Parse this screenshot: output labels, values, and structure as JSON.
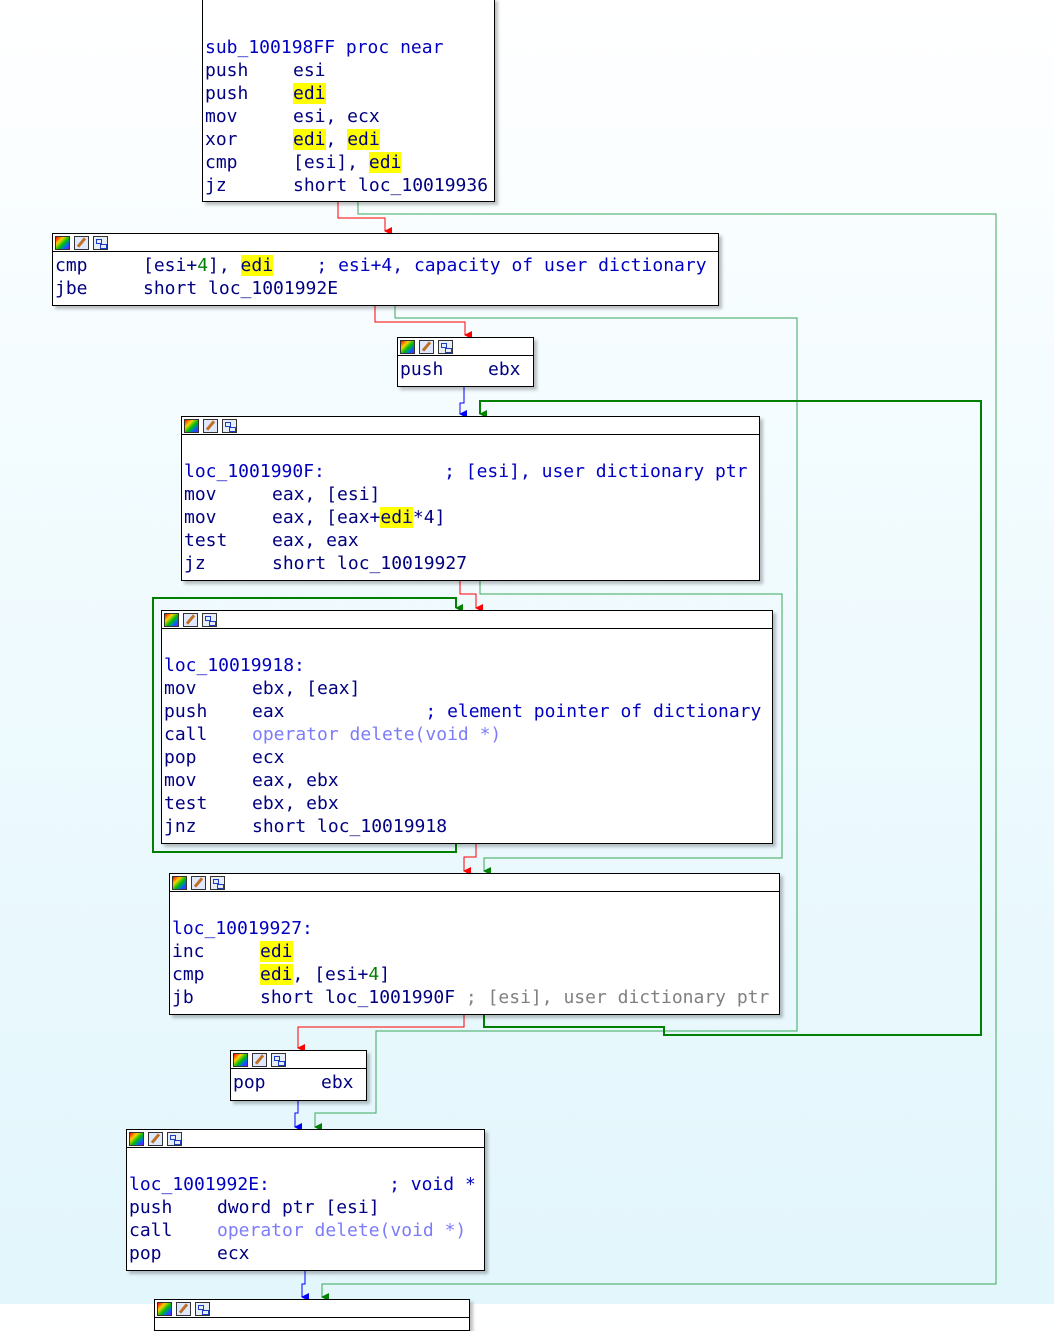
{
  "highlight_word": "edi",
  "blocks": [
    {
      "id": "b1",
      "header": false,
      "lines": [
        {
          "type": "label",
          "text": "sub_100198FF proc near"
        },
        {
          "type": "ins",
          "mn": "push",
          "ops": [
            {
              "t": "esi"
            }
          ]
        },
        {
          "type": "ins",
          "mn": "push",
          "ops": [
            {
              "t": "edi",
              "k": "hl"
            }
          ]
        },
        {
          "type": "ins",
          "mn": "mov",
          "ops": [
            {
              "t": "esi, ecx"
            }
          ]
        },
        {
          "type": "ins",
          "mn": "xor",
          "ops": [
            {
              "t": "edi",
              "k": "hl"
            },
            {
              "t": ", "
            },
            {
              "t": "edi",
              "k": "hl"
            }
          ]
        },
        {
          "type": "ins",
          "mn": "cmp",
          "ops": [
            {
              "t": "[esi], "
            },
            {
              "t": "edi",
              "k": "hl"
            }
          ]
        },
        {
          "type": "ins",
          "mn": "jz",
          "ops": [
            {
              "t": "short loc_10019936"
            }
          ]
        }
      ]
    },
    {
      "id": "b2",
      "header": true,
      "lines": [
        {
          "type": "ins",
          "mn": "cmp",
          "ops": [
            {
              "t": "[esi+"
            },
            {
              "t": "4",
              "k": "num"
            },
            {
              "t": "], "
            },
            {
              "t": "edi",
              "k": "hl"
            },
            {
              "t": "    ; esi+4, capacity of user dictionary",
              "k": "cmt"
            }
          ]
        },
        {
          "type": "ins",
          "mn": "jbe",
          "ops": [
            {
              "t": "short loc_1001992E"
            }
          ]
        }
      ]
    },
    {
      "id": "b3",
      "header": true,
      "lines": [
        {
          "type": "ins",
          "mn": "push",
          "ops": [
            {
              "t": "ebx"
            }
          ]
        }
      ]
    },
    {
      "id": "b4",
      "header": true,
      "lines": [
        {
          "type": "blank",
          "text": ""
        },
        {
          "type": "label",
          "text": "loc_1001990F:           ; [esi], user dictionary ptr"
        },
        {
          "type": "ins",
          "mn": "mov",
          "ops": [
            {
              "t": "eax, [esi]"
            }
          ]
        },
        {
          "type": "ins",
          "mn": "mov",
          "ops": [
            {
              "t": "eax, [eax+"
            },
            {
              "t": "edi",
              "k": "hl"
            },
            {
              "t": "*4]"
            }
          ]
        },
        {
          "type": "ins",
          "mn": "test",
          "ops": [
            {
              "t": "eax, eax"
            }
          ]
        },
        {
          "type": "ins",
          "mn": "jz",
          "ops": [
            {
              "t": "short loc_10019927"
            }
          ]
        }
      ]
    },
    {
      "id": "b5",
      "header": true,
      "lines": [
        {
          "type": "blank",
          "text": ""
        },
        {
          "type": "label",
          "text": "loc_10019918:"
        },
        {
          "type": "ins",
          "mn": "mov",
          "ops": [
            {
              "t": "ebx, [eax]"
            }
          ]
        },
        {
          "type": "ins",
          "mn": "push",
          "ops": [
            {
              "t": "eax"
            },
            {
              "t": "             ; element pointer of dictionary",
              "k": "cmt"
            }
          ]
        },
        {
          "type": "ins",
          "mn": "call",
          "ops": [
            {
              "t": "operator delete(void *)",
              "k": "api"
            }
          ]
        },
        {
          "type": "ins",
          "mn": "pop",
          "ops": [
            {
              "t": "ecx"
            }
          ]
        },
        {
          "type": "ins",
          "mn": "mov",
          "ops": [
            {
              "t": "eax, ebx"
            }
          ]
        },
        {
          "type": "ins",
          "mn": "test",
          "ops": [
            {
              "t": "ebx, ebx"
            }
          ]
        },
        {
          "type": "ins",
          "mn": "jnz",
          "ops": [
            {
              "t": "short loc_10019918"
            }
          ]
        }
      ]
    },
    {
      "id": "b6",
      "header": true,
      "lines": [
        {
          "type": "blank",
          "text": ""
        },
        {
          "type": "label",
          "text": "loc_10019927:"
        },
        {
          "type": "ins",
          "mn": "inc",
          "ops": [
            {
              "t": "edi",
              "k": "hl"
            }
          ]
        },
        {
          "type": "ins",
          "mn": "cmp",
          "ops": [
            {
              "t": "edi",
              "k": "hl"
            },
            {
              "t": ", [esi+"
            },
            {
              "t": "4",
              "k": "num"
            },
            {
              "t": "]"
            }
          ]
        },
        {
          "type": "ins",
          "mn": "jb",
          "ops": [
            {
              "t": "short loc_1001990F"
            },
            {
              "t": " ; [esi], user dictionary ptr",
              "k": "cmtg"
            }
          ]
        }
      ]
    },
    {
      "id": "b7",
      "header": true,
      "lines": [
        {
          "type": "ins",
          "mn": "pop",
          "ops": [
            {
              "t": "ebx"
            }
          ]
        }
      ]
    },
    {
      "id": "b8",
      "header": true,
      "lines": [
        {
          "type": "blank",
          "text": ""
        },
        {
          "type": "label",
          "text": "loc_1001992E:           ; void *"
        },
        {
          "type": "ins",
          "mn": "push",
          "ops": [
            {
              "t": "dword ptr [esi]"
            }
          ]
        },
        {
          "type": "ins",
          "mn": "call",
          "ops": [
            {
              "t": "operator delete(void *)",
              "k": "api"
            }
          ]
        },
        {
          "type": "ins",
          "mn": "pop",
          "ops": [
            {
              "t": "ecx"
            }
          ]
        }
      ]
    },
    {
      "id": "b9",
      "header": true,
      "lines": []
    }
  ],
  "edge_colors": {
    "taken": "#008000",
    "not_taken": "#ff0000",
    "normal": "#0000ff",
    "far_taken": "#3aa85a"
  }
}
